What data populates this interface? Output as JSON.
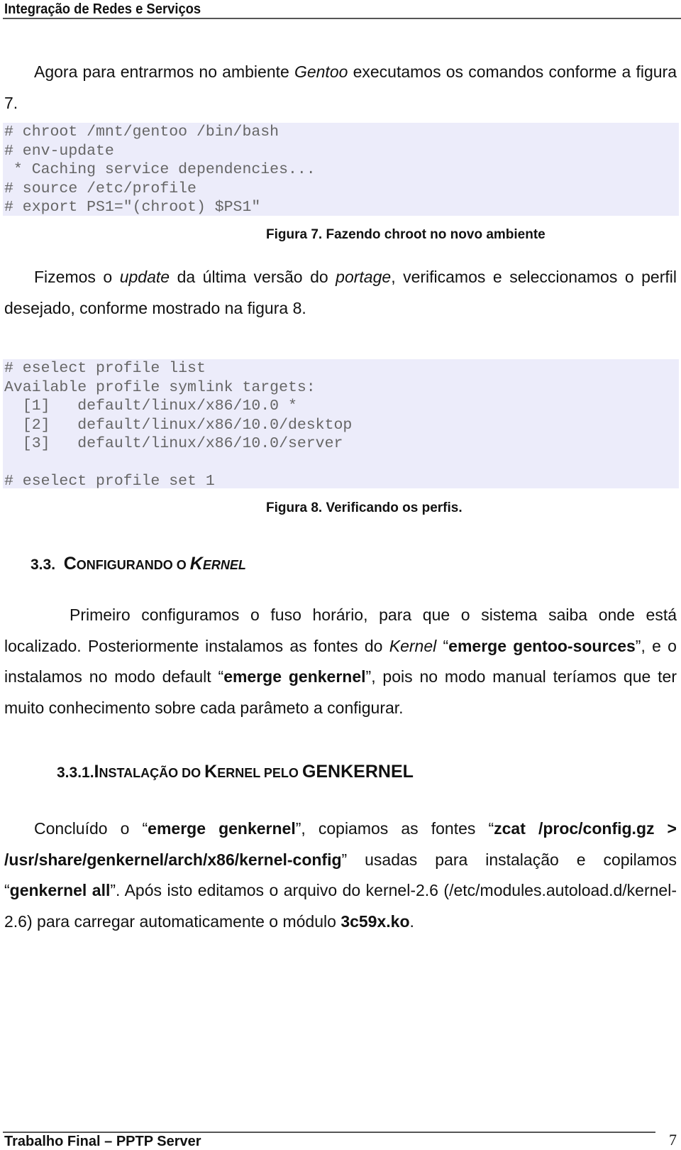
{
  "header": {
    "running_title": "Integração de Redes e Serviços"
  },
  "intro": {
    "p1_a": "Agora para entrarmos no ambiente ",
    "p1_b": "Gentoo",
    "p1_c": " executamos os comandos conforme a figura 7."
  },
  "figure7": {
    "code_lines": [
      "# chroot /mnt/gentoo /bin/bash",
      "# env-update",
      " * Caching service dependencies...",
      "# source /etc/profile",
      "# export PS1=\"(chroot) $PS1\""
    ],
    "caption": "Figura 7. Fazendo chroot no novo ambiente"
  },
  "update_para": {
    "a": "Fizemos o ",
    "b": "update",
    "c": " da última versão do ",
    "d": "portage",
    "e": ", verificamos e seleccionamos o perfil desejado, conforme mostrado na figura 8."
  },
  "figure8": {
    "code_lines": [
      "# eselect profile list",
      "Available profile symlink targets:",
      "  [1]   default/linux/x86/10.0 *",
      "  [2]   default/linux/x86/10.0/desktop",
      "  [3]   default/linux/x86/10.0/server",
      "",
      "# eselect profile set 1"
    ],
    "caption": "Figura 8. Verificando os perfis."
  },
  "section_3_3": {
    "number": "3.3.",
    "title_a": "C",
    "title_b": "ONFIGURANDO O ",
    "title_c": "K",
    "title_d": "ERNEL",
    "p_a": "Primeiro configuramos o fuso horário, para que o sistema saiba onde está localizado. Posteriormente instalamos as fontes do ",
    "p_b": "Kernel",
    "p_c": "  “",
    "p_d": "emerge gentoo-sources",
    "p_e": "”, e o instalamos no modo default “",
    "p_f": "emerge genkernel",
    "p_g": "”, pois no modo manual teríamos que ter muito conhecimento sobre cada parâmeto a configurar."
  },
  "section_3_3_1": {
    "number": "3.3.1.",
    "t1": "I",
    "t2": "NSTALAÇÃO DO ",
    "t3": "K",
    "t4": "ERNEL PELO ",
    "t5": "GENKERNEL",
    "p_a": "Concluído o “",
    "p_b": "emerge genkernel",
    "p_c": "”, copiamos as fontes “",
    "p_d": "zcat /proc/config.gz > /usr/share/genkernel/arch/x86/kernel-config",
    "p_e": "” usadas para instalação e copilamos “",
    "p_f": "genkernel all",
    "p_g": "”. Após isto editamos o arquivo do kernel-2.6 (/etc/modules.autoload.d/kernel-2.6) para carregar automaticamente o módulo ",
    "p_h": "3c59x.ko",
    "p_i": "."
  },
  "footer": {
    "text": "Trabalho Final –  PPTP Server",
    "page_number": "7"
  }
}
